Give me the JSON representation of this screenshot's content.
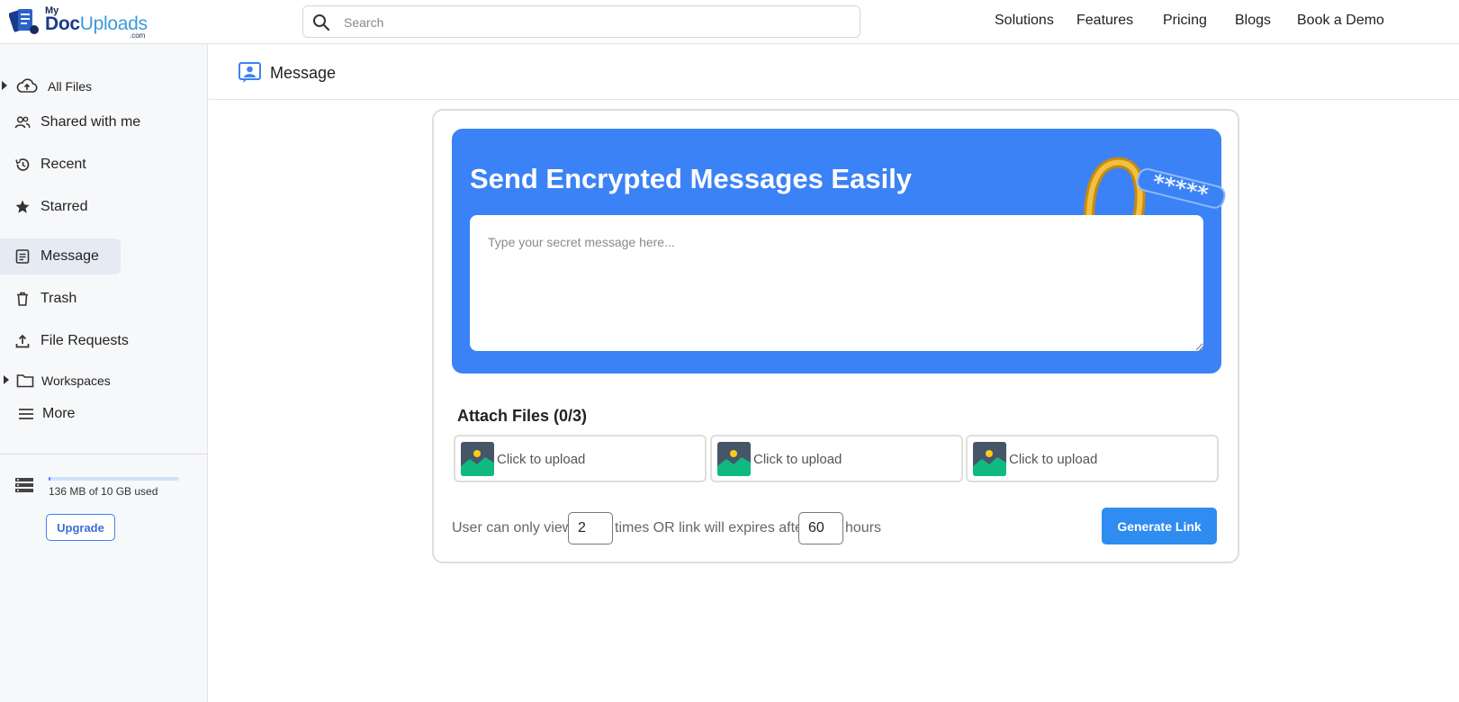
{
  "brand": {
    "my": "My",
    "doc": "Doc",
    "uploads": "Uploads",
    "com": ".com"
  },
  "search": {
    "placeholder": "Search",
    "value": ""
  },
  "nav": [
    "Solutions",
    "Features",
    "Pricing",
    "Blogs",
    "Book a Demo"
  ],
  "sidebar": {
    "items": [
      {
        "label": "All Files",
        "icon": "cloud-upload-icon"
      },
      {
        "label": "Shared with me",
        "icon": "people-icon"
      },
      {
        "label": "Recent",
        "icon": "history-icon"
      },
      {
        "label": "Starred",
        "icon": "star-icon"
      },
      {
        "label": "Message",
        "icon": "message-icon",
        "active": true
      },
      {
        "label": "Trash",
        "icon": "trash-icon"
      },
      {
        "label": "File Requests",
        "icon": "upload-icon"
      },
      {
        "label": "Workspaces",
        "icon": "folder-icon"
      },
      {
        "label": "More",
        "icon": "menu-icon"
      }
    ],
    "storage": {
      "text": "136 MB of 10 GB used",
      "used_fraction": 0.0133
    },
    "upgrade_label": "Upgrade"
  },
  "page": {
    "title": "Message"
  },
  "hero": {
    "heading": "Send Encrypted Messages Easily",
    "password_mask": "*****",
    "message_placeholder": "Type your secret message here...",
    "message_value": ""
  },
  "attach": {
    "title": "Attach Files (0/3)",
    "slots": [
      {
        "label": "Click to upload"
      },
      {
        "label": "Click to upload"
      },
      {
        "label": "Click to upload"
      }
    ]
  },
  "options": {
    "text_before_views": "User can only view",
    "views": "2",
    "text_middle": "times OR link will expires after",
    "hours": "60",
    "text_after": "hours"
  },
  "generate_label": "Generate Link",
  "colors": {
    "accent": "#3b82f6",
    "button": "#2f8cf0",
    "sidebar_bg": "#f7f8fa",
    "active_bg": "#e5eaf3"
  }
}
